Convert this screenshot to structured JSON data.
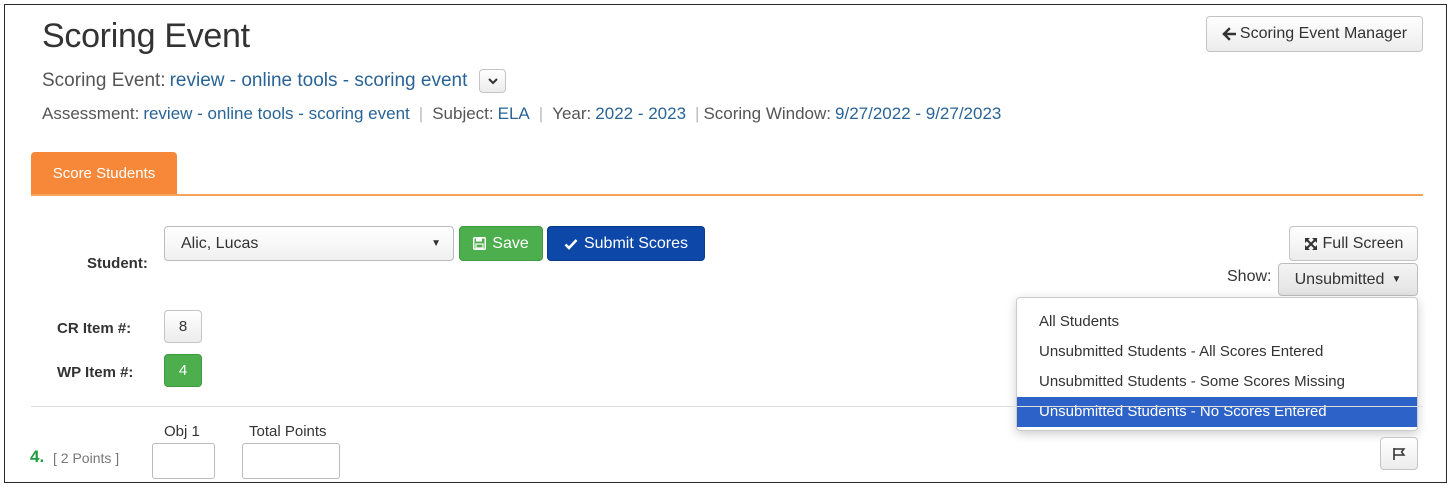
{
  "header": {
    "title": "Scoring Event",
    "manager_button": "Scoring Event Manager"
  },
  "event": {
    "label": "Scoring Event:",
    "value": "review - online tools - scoring event"
  },
  "meta": {
    "assessment_label": "Assessment:",
    "assessment_value": "review - online tools - scoring event",
    "subject_label": "Subject:",
    "subject_value": "ELA",
    "year_label": "Year:",
    "year_value": "2022 - 2023",
    "window_label": "Scoring Window:",
    "window_value": "9/27/2022 - 9/27/2023"
  },
  "tabs": [
    {
      "label": "Score Students",
      "active": true
    }
  ],
  "student": {
    "label": "Student:",
    "selected": "Alic, Lucas"
  },
  "actions": {
    "save": "Save",
    "submit": "Submit Scores",
    "full_screen": "Full Screen"
  },
  "show": {
    "label": "Show:",
    "selected": "Unsubmitted",
    "options": [
      "All Students",
      "Unsubmitted Students - All Scores Entered",
      "Unsubmitted Students - Some Scores Missing",
      "Unsubmitted Students - No Scores Entered"
    ],
    "highlighted_index": 3
  },
  "items": {
    "cr_label": "CR Item #:",
    "cr_value": "8",
    "wp_label": "WP Item #:",
    "wp_value": "4"
  },
  "question": {
    "number": "4.",
    "points": "[ 2 Points ]",
    "columns": [
      "Obj 1",
      "Total Points"
    ]
  },
  "colors": {
    "tab_orange": "#f7883a",
    "link_blue": "#2a6496",
    "save_green": "#4cae4c",
    "submit_blue": "#0d47a8",
    "menu_highlight": "#2d62c8",
    "question_green": "#1e9c3e"
  },
  "icons": {
    "manager_back": "arrow-left-icon",
    "event_dropdown": "chevron-down-icon",
    "student_dropdown": "caret-down-icon",
    "save": "floppy-disk-icon",
    "submit": "checkmark-icon",
    "full_screen": "expand-arrows-icon",
    "show_dropdown": "caret-down-icon",
    "flag": "flag-icon"
  }
}
